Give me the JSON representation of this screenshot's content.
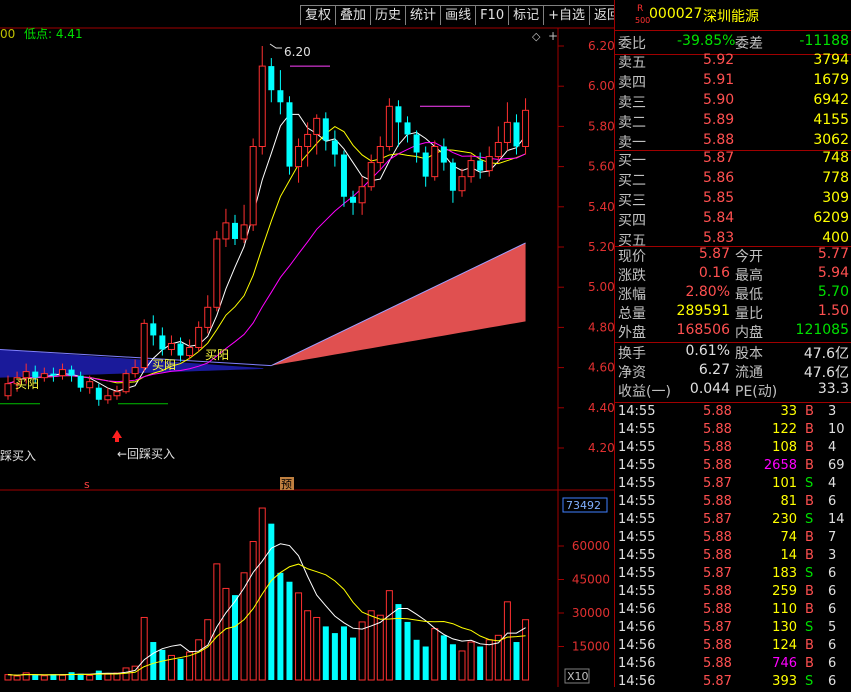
{
  "toolbar": {
    "buttons": [
      "复权",
      "叠加",
      "历史",
      "统计",
      "画线",
      "F10",
      "标记",
      "+自选",
      "返回"
    ]
  },
  "chart": {
    "left_value": "00",
    "low_label": "低点: 4.41",
    "high_label": "6.20",
    "price_ticks": [
      "6.20",
      "6.00",
      "5.80",
      "5.60",
      "5.40",
      "5.20",
      "5.00",
      "4.80",
      "4.60",
      "4.40",
      "4.20"
    ],
    "volume_ticks": [
      "60000",
      "45000",
      "30000",
      "15000"
    ],
    "volume_box": "73492",
    "x10_label": "X10",
    "annotations": {
      "buy_yang_1": "买阳",
      "buy_yang_2": "买阳",
      "buy_yang_3": "买阳",
      "pullback_buy_left": "踩买入",
      "pullback_buy": "←回踩买入",
      "marker_s": "s",
      "marker_yu": "预"
    },
    "colors": {
      "up": "#ff3030",
      "down": "#00ffff",
      "ma5": "#ffffff",
      "ma10": "#ffff00",
      "ma20": "#ff00ff",
      "blue_band": "#2020c0",
      "red_band": "#e05050",
      "axis": "#a00000"
    }
  },
  "chart_data": {
    "type": "candlestick",
    "ylim": [
      4.12,
      6.28
    ],
    "candles": [
      {
        "o": 4.46,
        "c": 4.52,
        "h": 4.56,
        "l": 4.44
      },
      {
        "o": 4.52,
        "c": 4.55,
        "h": 4.58,
        "l": 4.48
      },
      {
        "o": 4.55,
        "c": 4.58,
        "h": 4.62,
        "l": 4.52
      },
      {
        "o": 4.58,
        "c": 4.55,
        "h": 4.61,
        "l": 4.52
      },
      {
        "o": 4.55,
        "c": 4.57,
        "h": 4.6,
        "l": 4.53
      },
      {
        "o": 4.57,
        "c": 4.56,
        "h": 4.6,
        "l": 4.53
      },
      {
        "o": 4.56,
        "c": 4.59,
        "h": 4.62,
        "l": 4.54
      },
      {
        "o": 4.59,
        "c": 4.56,
        "h": 4.61,
        "l": 4.53
      },
      {
        "o": 4.56,
        "c": 4.5,
        "h": 4.58,
        "l": 4.48
      },
      {
        "o": 4.5,
        "c": 4.53,
        "h": 4.56,
        "l": 4.47
      },
      {
        "o": 4.5,
        "c": 4.44,
        "h": 4.52,
        "l": 4.41
      },
      {
        "o": 4.44,
        "c": 4.46,
        "h": 4.5,
        "l": 4.42
      },
      {
        "o": 4.46,
        "c": 4.48,
        "h": 4.51,
        "l": 4.44
      },
      {
        "o": 4.48,
        "c": 4.57,
        "h": 4.59,
        "l": 4.47
      },
      {
        "o": 4.57,
        "c": 4.6,
        "h": 4.64,
        "l": 4.55
      },
      {
        "o": 4.6,
        "c": 4.82,
        "h": 4.84,
        "l": 4.58
      },
      {
        "o": 4.82,
        "c": 4.76,
        "h": 4.86,
        "l": 4.71
      },
      {
        "o": 4.76,
        "c": 4.69,
        "h": 4.8,
        "l": 4.66
      },
      {
        "o": 4.69,
        "c": 4.72,
        "h": 4.76,
        "l": 4.66
      },
      {
        "o": 4.72,
        "c": 4.66,
        "h": 4.75,
        "l": 4.63
      },
      {
        "o": 4.66,
        "c": 4.7,
        "h": 4.74,
        "l": 4.64
      },
      {
        "o": 4.7,
        "c": 4.8,
        "h": 4.83,
        "l": 4.68
      },
      {
        "o": 4.8,
        "c": 4.9,
        "h": 4.96,
        "l": 4.77
      },
      {
        "o": 4.9,
        "c": 5.24,
        "h": 5.28,
        "l": 4.88
      },
      {
        "o": 5.24,
        "c": 5.32,
        "h": 5.39,
        "l": 5.2
      },
      {
        "o": 5.32,
        "c": 5.24,
        "h": 5.36,
        "l": 5.21
      },
      {
        "o": 5.24,
        "c": 5.31,
        "h": 5.41,
        "l": 5.22
      },
      {
        "o": 5.31,
        "c": 5.7,
        "h": 5.74,
        "l": 5.28
      },
      {
        "o": 5.7,
        "c": 6.1,
        "h": 6.2,
        "l": 5.66
      },
      {
        "o": 6.1,
        "c": 5.98,
        "h": 6.14,
        "l": 5.92
      },
      {
        "o": 5.98,
        "c": 5.92,
        "h": 6.08,
        "l": 5.86
      },
      {
        "o": 5.92,
        "c": 5.6,
        "h": 5.95,
        "l": 5.56
      },
      {
        "o": 5.6,
        "c": 5.7,
        "h": 5.74,
        "l": 5.52
      },
      {
        "o": 5.7,
        "c": 5.76,
        "h": 5.82,
        "l": 5.6
      },
      {
        "o": 5.76,
        "c": 5.84,
        "h": 5.86,
        "l": 5.66
      },
      {
        "o": 5.84,
        "c": 5.73,
        "h": 5.87,
        "l": 5.68
      },
      {
        "o": 5.73,
        "c": 5.66,
        "h": 5.78,
        "l": 5.6
      },
      {
        "o": 5.66,
        "c": 5.45,
        "h": 5.68,
        "l": 5.4
      },
      {
        "o": 5.45,
        "c": 5.42,
        "h": 5.48,
        "l": 5.36
      },
      {
        "o": 5.42,
        "c": 5.5,
        "h": 5.55,
        "l": 5.36
      },
      {
        "o": 5.5,
        "c": 5.62,
        "h": 5.66,
        "l": 5.48
      },
      {
        "o": 5.62,
        "c": 5.7,
        "h": 5.75,
        "l": 5.58
      },
      {
        "o": 5.7,
        "c": 5.9,
        "h": 5.94,
        "l": 5.68
      },
      {
        "o": 5.9,
        "c": 5.82,
        "h": 5.93,
        "l": 5.7
      },
      {
        "o": 5.82,
        "c": 5.76,
        "h": 5.85,
        "l": 5.72
      },
      {
        "o": 5.76,
        "c": 5.67,
        "h": 5.78,
        "l": 5.62
      },
      {
        "o": 5.67,
        "c": 5.55,
        "h": 5.7,
        "l": 5.5
      },
      {
        "o": 5.55,
        "c": 5.7,
        "h": 5.73,
        "l": 5.53
      },
      {
        "o": 5.7,
        "c": 5.62,
        "h": 5.74,
        "l": 5.58
      },
      {
        "o": 5.62,
        "c": 5.48,
        "h": 5.64,
        "l": 5.42
      },
      {
        "o": 5.48,
        "c": 5.55,
        "h": 5.59,
        "l": 5.45
      },
      {
        "o": 5.55,
        "c": 5.63,
        "h": 5.66,
        "l": 5.52
      },
      {
        "o": 5.63,
        "c": 5.58,
        "h": 5.67,
        "l": 5.54
      },
      {
        "o": 5.58,
        "c": 5.65,
        "h": 5.7,
        "l": 5.55
      },
      {
        "o": 5.65,
        "c": 5.72,
        "h": 5.8,
        "l": 5.62
      },
      {
        "o": 5.72,
        "c": 5.82,
        "h": 5.92,
        "l": 5.68
      },
      {
        "o": 5.82,
        "c": 5.7,
        "h": 5.86,
        "l": 5.66
      },
      {
        "o": 5.7,
        "c": 5.88,
        "h": 5.94,
        "l": 5.66
      }
    ],
    "volume": [
      2400,
      1800,
      3200,
      2200,
      1900,
      2600,
      2100,
      3500,
      2800,
      2000,
      4200,
      2600,
      3100,
      5400,
      6200,
      28000,
      17000,
      13500,
      11000,
      9500,
      12500,
      18000,
      27000,
      52000,
      41000,
      38000,
      48000,
      62000,
      77000,
      70000,
      48000,
      44000,
      39000,
      31000,
      28000,
      24000,
      21000,
      24000,
      19000,
      26000,
      31000,
      29000,
      40000,
      34000,
      26000,
      18000,
      15000,
      23000,
      20000,
      16000,
      13000,
      17000,
      15000,
      18000,
      20000,
      35000,
      17000,
      27000
    ]
  },
  "quote": {
    "code": "000027",
    "name": "深圳能源",
    "r_label": "R",
    "r_sub": "500",
    "weibi_label": "委比",
    "weibi_value": "-39.85%",
    "weicha_label": "委差",
    "weicha_value": "-11188",
    "asks": [
      {
        "label": "卖五",
        "price": "5.92",
        "vol": "3794"
      },
      {
        "label": "卖四",
        "price": "5.91",
        "vol": "1679"
      },
      {
        "label": "卖三",
        "price": "5.90",
        "vol": "6942"
      },
      {
        "label": "卖二",
        "price": "5.89",
        "vol": "4155"
      },
      {
        "label": "卖一",
        "price": "5.88",
        "vol": "3062"
      }
    ],
    "bids": [
      {
        "label": "买一",
        "price": "5.87",
        "vol": "748"
      },
      {
        "label": "买二",
        "price": "5.86",
        "vol": "778"
      },
      {
        "label": "买三",
        "price": "5.85",
        "vol": "309"
      },
      {
        "label": "买四",
        "price": "5.84",
        "vol": "6209"
      },
      {
        "label": "买五",
        "price": "5.83",
        "vol": "400"
      }
    ],
    "stats": [
      {
        "l1": "现价",
        "v1": "5.87",
        "c1": "red",
        "l2": "今开",
        "v2": "5.77",
        "c2": "red"
      },
      {
        "l1": "涨跌",
        "v1": "0.16",
        "c1": "red",
        "l2": "最高",
        "v2": "5.94",
        "c2": "red"
      },
      {
        "l1": "涨幅",
        "v1": "2.80%",
        "c1": "red",
        "l2": "最低",
        "v2": "5.70",
        "c2": "grn"
      },
      {
        "l1": "总量",
        "v1": "289591",
        "c1": "yel",
        "l2": "量比",
        "v2": "1.50",
        "c2": "red"
      },
      {
        "l1": "外盘",
        "v1": "168506",
        "c1": "red",
        "l2": "内盘",
        "v2": "121085",
        "c2": "grn"
      }
    ],
    "stats2": [
      {
        "l1": "换手",
        "v1": "0.61%",
        "l2": "股本",
        "v2": "47.6亿"
      },
      {
        "l1": "净资",
        "v1": "6.27",
        "l2": "流通",
        "v2": "47.6亿"
      },
      {
        "l1": "收益(一)",
        "v1": "0.044",
        "l2": "PE(动)",
        "v2": "33.3"
      }
    ],
    "ticks": [
      {
        "t": "14:55",
        "p": "5.88",
        "v": "33",
        "vc": "yel",
        "bs": "B",
        "n": "3"
      },
      {
        "t": "14:55",
        "p": "5.88",
        "v": "122",
        "vc": "yel",
        "bs": "B",
        "n": "10"
      },
      {
        "t": "14:55",
        "p": "5.88",
        "v": "108",
        "vc": "yel",
        "bs": "B",
        "n": "4"
      },
      {
        "t": "14:55",
        "p": "5.88",
        "v": "2658",
        "vc": "mag",
        "bs": "B",
        "n": "69"
      },
      {
        "t": "14:55",
        "p": "5.87",
        "v": "101",
        "vc": "yel",
        "bs": "S",
        "n": "4"
      },
      {
        "t": "14:55",
        "p": "5.88",
        "v": "81",
        "vc": "yel",
        "bs": "B",
        "n": "6"
      },
      {
        "t": "14:55",
        "p": "5.87",
        "v": "230",
        "vc": "yel",
        "bs": "S",
        "n": "14"
      },
      {
        "t": "14:55",
        "p": "5.88",
        "v": "74",
        "vc": "yel",
        "bs": "B",
        "n": "7"
      },
      {
        "t": "14:55",
        "p": "5.88",
        "v": "14",
        "vc": "yel",
        "bs": "B",
        "n": "3"
      },
      {
        "t": "14:55",
        "p": "5.87",
        "v": "183",
        "vc": "yel",
        "bs": "S",
        "n": "6"
      },
      {
        "t": "14:55",
        "p": "5.88",
        "v": "259",
        "vc": "yel",
        "bs": "B",
        "n": "6"
      },
      {
        "t": "14:56",
        "p": "5.88",
        "v": "110",
        "vc": "yel",
        "bs": "B",
        "n": "6"
      },
      {
        "t": "14:56",
        "p": "5.87",
        "v": "130",
        "vc": "yel",
        "bs": "S",
        "n": "5"
      },
      {
        "t": "14:56",
        "p": "5.88",
        "v": "124",
        "vc": "yel",
        "bs": "B",
        "n": "6"
      },
      {
        "t": "14:56",
        "p": "5.88",
        "v": "746",
        "vc": "mag",
        "bs": "B",
        "n": "6"
      },
      {
        "t": "14:56",
        "p": "5.87",
        "v": "393",
        "vc": "yel",
        "bs": "S",
        "n": "6"
      }
    ]
  }
}
